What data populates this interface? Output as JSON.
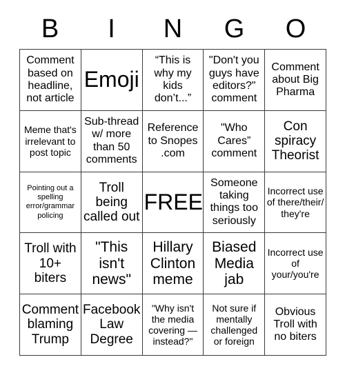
{
  "card": {
    "title": "BINGO",
    "header_letters": [
      "B",
      "I",
      "N",
      "G",
      "O"
    ],
    "grid_size": "5x5",
    "free_space": "FREE",
    "cells": [
      {
        "text": "Comment based on headline, not article",
        "size": "fs-md"
      },
      {
        "text": "Emoji",
        "size": "fs-huge"
      },
      {
        "text": "“This is why my kids don’t...”",
        "size": "fs-md"
      },
      {
        "text": "\"Don't you guys have editors?\" comment",
        "size": "fs-md"
      },
      {
        "text": "Comment about Big Pharma",
        "size": "fs-md"
      },
      {
        "text": "Meme that's irrelevant to post topic",
        "size": "fs-sm"
      },
      {
        "text": "Sub-thread w/ more than 50 comments",
        "size": "fs-md"
      },
      {
        "text": "Reference to Snopes .com",
        "size": "fs-md"
      },
      {
        "text": "\"Who Cares” comment",
        "size": "fs-md"
      },
      {
        "text": "Con spiracy Theorist",
        "size": "fs-lg"
      },
      {
        "text": "Pointing out a spelling error/grammar policing",
        "size": "fs-xs"
      },
      {
        "text": "Troll being called out",
        "size": "fs-lg"
      },
      {
        "text": "FREE",
        "size": "fs-huge"
      },
      {
        "text": "Someone taking things too seriously",
        "size": "fs-md"
      },
      {
        "text": "Incorrect use of there/their/ they're",
        "size": "fs-sm"
      },
      {
        "text": "Troll with 10+ biters",
        "size": "fs-lg"
      },
      {
        "text": "\"This isn't news\"",
        "size": "fs-xl"
      },
      {
        "text": "Hillary Clinton meme",
        "size": "fs-xl"
      },
      {
        "text": "Biased Media jab",
        "size": "fs-xl"
      },
      {
        "text": "Incorrect use of your/you're",
        "size": "fs-sm"
      },
      {
        "text": "Comment blaming Trump",
        "size": "fs-lg"
      },
      {
        "text": "Facebook Law Degree",
        "size": "fs-lg"
      },
      {
        "text": "\"Why isn't the media covering — instead?\"",
        "size": "fs-sm"
      },
      {
        "text": "Not sure if mentally challenged or foreign",
        "size": "fs-sm"
      },
      {
        "text": "Obvious Troll with no biters",
        "size": "fs-md"
      }
    ]
  },
  "colors": {
    "background": "#ffffff",
    "text": "#000000",
    "grid_line": "#3a3a3a"
  }
}
